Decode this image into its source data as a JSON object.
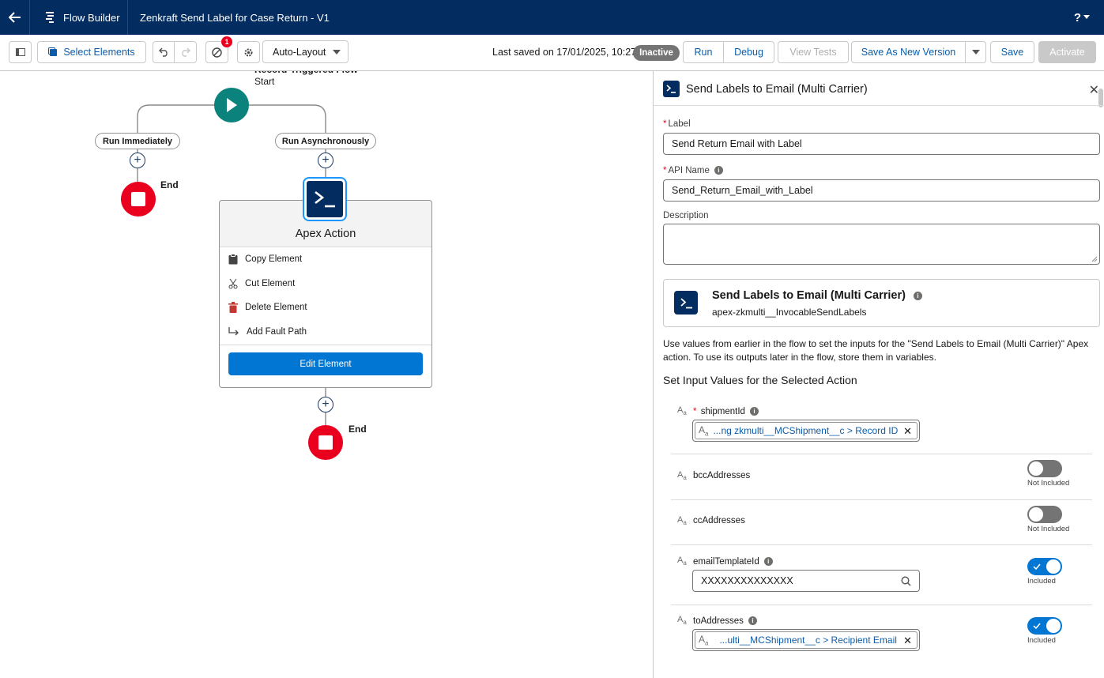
{
  "header": {
    "app_name": "Flow Builder",
    "flow_title": "Zenkraft Send Label for Case Return - V1",
    "help": "?"
  },
  "toolbar": {
    "select_elements": "Select Elements",
    "error_count": "1",
    "layout_mode": "Auto-Layout",
    "last_saved": "Last saved on 17/01/2025, 10:27",
    "status": "Inactive",
    "run": "Run",
    "debug": "Debug",
    "view_tests": "View Tests",
    "save_new_version": "Save As New Version",
    "save": "Save",
    "activate": "Activate"
  },
  "canvas": {
    "start_type": "Record-Triggered Flow",
    "start_label": "Start",
    "path_immediate": "Run Immediately",
    "path_async": "Run Asynchronously",
    "end_label_1": "End",
    "end_label_2": "End",
    "popover": {
      "title": "Apex Action",
      "items": [
        "Copy Element",
        "Cut Element",
        "Delete Element",
        "Add Fault Path"
      ],
      "edit_button": "Edit Element"
    }
  },
  "panel": {
    "title": "Send Labels to Email (Multi Carrier)",
    "label_field": {
      "label": "Label",
      "value": "Send Return Email with Label"
    },
    "api_name_field": {
      "label": "API Name",
      "value": "Send_Return_Email_with_Label"
    },
    "description_field": {
      "label": "Description",
      "value": ""
    },
    "action_card": {
      "name": "Send Labels to Email (Multi Carrier)",
      "api": "apex-zkmulti__InvocableSendLabels"
    },
    "instructions": "Use values from earlier in the flow to set the inputs for the \"Send Labels to Email (Multi Carrier)\" Apex action. To use its outputs later in the flow, store them in variables.",
    "section_title": "Set Input Values for the Selected Action",
    "type_icon": "A",
    "type_icon_sub": "a",
    "params": [
      {
        "name": "shipmentId",
        "required": true,
        "value": "...ng zkmulti__MCShipment__c > Record ID"
      },
      {
        "name": "bccAddresses",
        "toggle_label": "Not Included"
      },
      {
        "name": "ccAddresses",
        "toggle_label": "Not Included"
      },
      {
        "name": "emailTemplateId",
        "value": "XXXXXXXXXXXXXX",
        "toggle_label": "Included"
      },
      {
        "name": "toAddresses",
        "value": "...ulti__MCShipment__c > Recipient Email",
        "toggle_label": "Included"
      }
    ]
  }
}
